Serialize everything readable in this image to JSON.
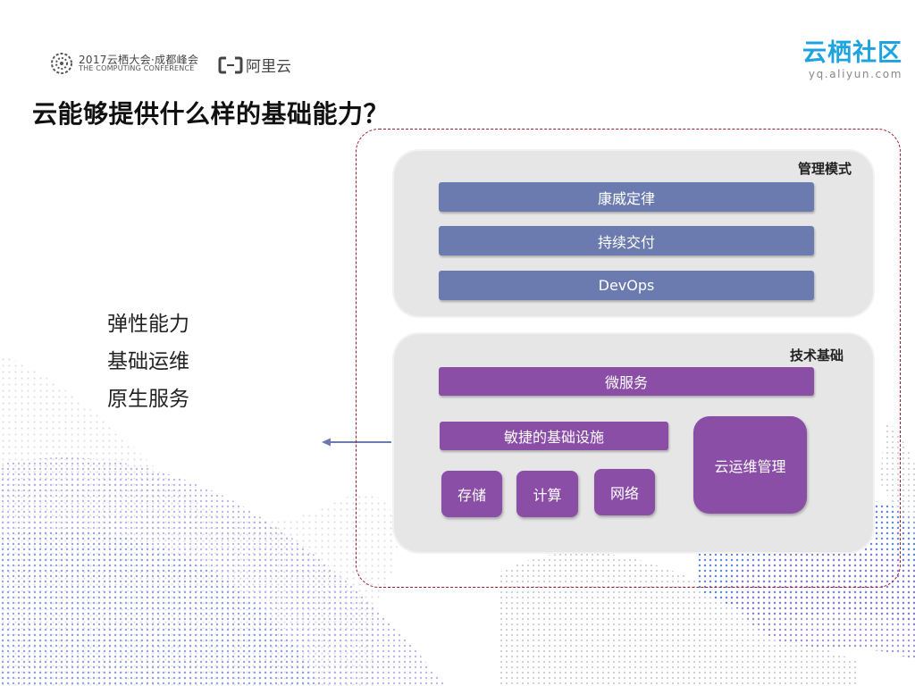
{
  "header": {
    "conference_cn": "2017云栖大会·成都峰会",
    "conference_en": "THE COMPUTING CONFERENCE",
    "aliyun_brand": "阿里云",
    "community_title": "云栖社区",
    "community_url": "yq.aliyun.com"
  },
  "title": "云能够提供什么样的基础能力？",
  "left_list": [
    "弹性能力",
    "基础运维",
    "原生服务"
  ],
  "management": {
    "label": "管理模式",
    "items": [
      "康威定律",
      "持续交付",
      "DevOps"
    ]
  },
  "tech": {
    "label": "技术基础",
    "microservice": "微服务",
    "agile_infra": "敏捷的基础设施",
    "storage": "存储",
    "compute": "计算",
    "network": "网络",
    "cloud_ops": "云运维管理"
  },
  "colors": {
    "blue_bar": "#6b7bb0",
    "purple_bar": "#8b4ea6",
    "panel": "#e6e6e6",
    "frame_dash": "#a01a2a",
    "community": "#1da4e0"
  }
}
